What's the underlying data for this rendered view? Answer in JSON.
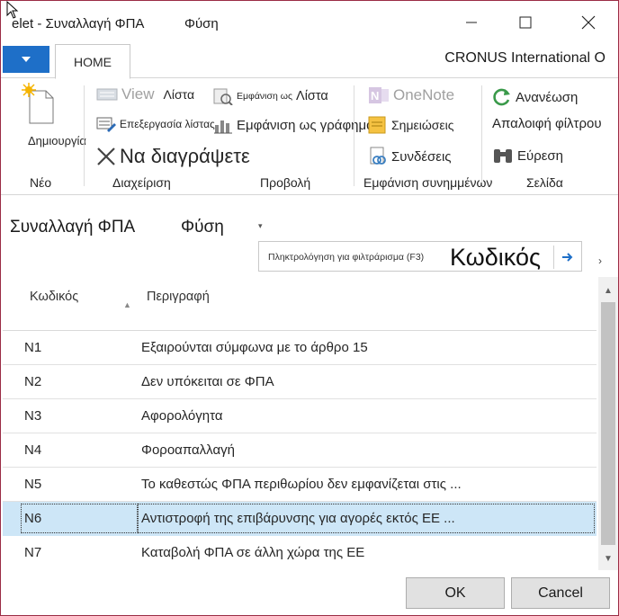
{
  "window": {
    "title": "elet - Συναλλαγή ΦΠΑ",
    "title_extra": "Φύση",
    "company": "CRONUS International O"
  },
  "ribbon": {
    "tab": "HOME",
    "new_label": "Δημιουργία",
    "view_list": "View",
    "view_list_suffix": "Λίστα",
    "edit_list": "Επεξεργασία λίστας",
    "delete": "Να διαγράψετε",
    "show_as_label": "Εμφάνιση ως",
    "show_as_list": "Λίστα",
    "show_as_chart": "Εμφάνιση ως γράφημα",
    "onenote": "OneNote",
    "notes": "Σημειώσεις",
    "links": "Συνδέσεις",
    "refresh": "Ανανέωση",
    "clear_filter": "Απαλοιφή φίλτρου",
    "find": "Εύρεση",
    "groups": {
      "new": "Νέο",
      "manage": "Διαχείριση",
      "view": "Προβολή",
      "attachments": "Εμφάνιση συνημμένων",
      "page": "Σελίδα"
    }
  },
  "page": {
    "title": "Συναλλαγή ΦΠΑ",
    "subtitle": "Φύση",
    "filter_placeholder": "Πληκτρολόγηση για φιλτράρισμα (F3)",
    "filter_field": "Κωδικός"
  },
  "list": {
    "columns": {
      "code": "Κωδικός",
      "description": "Περιγραφή"
    },
    "rows": [
      {
        "code": "N1",
        "description": "Εξαιρούνται σύμφωνα με το άρθρο 15"
      },
      {
        "code": "N2",
        "description": "Δεν υπόκειται σε ΦΠΑ"
      },
      {
        "code": "N3",
        "description": "Αφορολόγητα"
      },
      {
        "code": "N4",
        "description": "Φοροαπαλλαγή"
      },
      {
        "code": "N5",
        "description": "Το καθεστώς ΦΠΑ περιθωρίου δεν εμφανίζεται στις ..."
      },
      {
        "code": "N6",
        "description": "Αντιστροφή της επιβάρυνσης για αγορές εκτός ΕΕ ..."
      },
      {
        "code": "N7",
        "description": "Καταβολή ΦΠΑ σε άλλη χώρα της ΕΕ"
      }
    ],
    "selected_code": "N6"
  },
  "footer": {
    "ok": "OK",
    "cancel": "Cancel"
  },
  "colors": {
    "accent": "#1e6fc8",
    "selected_row": "#cde6f7",
    "window_border": "#9b2c45"
  }
}
